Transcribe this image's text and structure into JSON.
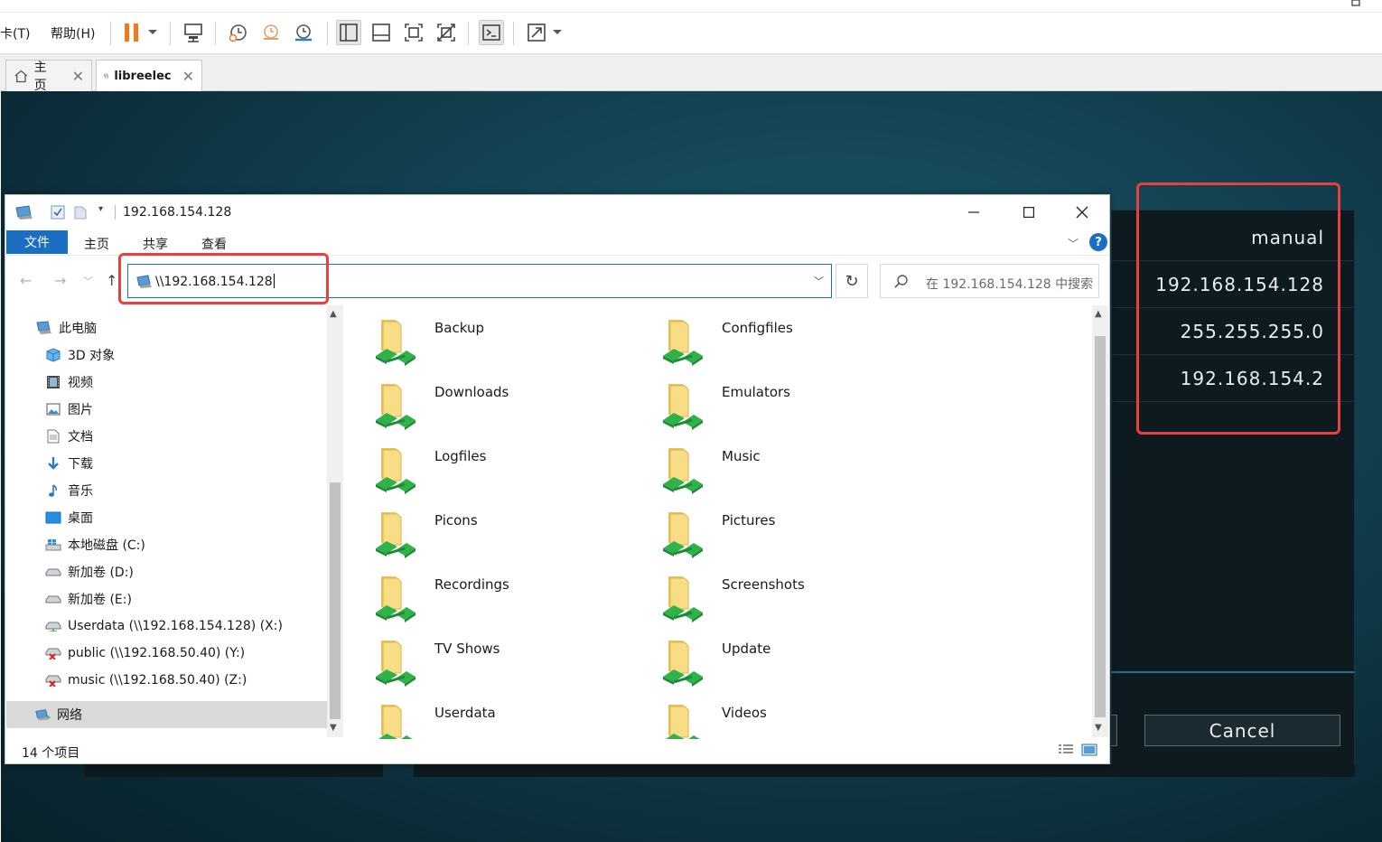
{
  "vm_toolbar": {
    "menu_tab_label": "卡(T)",
    "menu_help_label": "帮助(H)"
  },
  "vm_tabs": [
    {
      "label": "主页",
      "icon": "home-icon"
    },
    {
      "label": "libreelec",
      "icon": "vm-icon"
    }
  ],
  "kodi": {
    "values": [
      "manual",
      "192.168.154.128",
      "255.255.255.0",
      "192.168.154.2"
    ],
    "cancel_label": "Cancel"
  },
  "explorer": {
    "title": "192.168.154.128",
    "ribbon": {
      "file": "文件",
      "home": "主页",
      "share": "共享",
      "view": "查看",
      "help": "?"
    },
    "address": "\\\\192.168.154.128",
    "search_placeholder": "在 192.168.154.128 中搜索",
    "tree": [
      {
        "label": "此电脑",
        "icon": "computer-icon"
      },
      {
        "label": "3D 对象",
        "icon": "3d-objects-icon"
      },
      {
        "label": "视频",
        "icon": "video-icon"
      },
      {
        "label": "图片",
        "icon": "pictures-icon"
      },
      {
        "label": "文档",
        "icon": "documents-icon"
      },
      {
        "label": "下载",
        "icon": "download-icon"
      },
      {
        "label": "音乐",
        "icon": "music-icon"
      },
      {
        "label": "桌面",
        "icon": "desktop-icon"
      },
      {
        "label": "本地磁盘 (C:)",
        "icon": "windows-drive-icon"
      },
      {
        "label": "新加卷 (D:)",
        "icon": "drive-icon"
      },
      {
        "label": "新加卷 (E:)",
        "icon": "drive-icon"
      },
      {
        "label": "Userdata (\\\\192.168.154.128) (X:)",
        "icon": "network-drive-icon"
      },
      {
        "label": "public (\\\\192.168.50.40) (Y:)",
        "icon": "disconnected-drive-icon"
      },
      {
        "label": "music (\\\\192.168.50.40) (Z:)",
        "icon": "disconnected-drive-icon"
      },
      {
        "label": "网络",
        "icon": "network-icon"
      }
    ],
    "folders": [
      "Backup",
      "Configfiles",
      "Downloads",
      "Emulators",
      "Logfiles",
      "Music",
      "Picons",
      "Pictures",
      "Recordings",
      "Screenshots",
      "TV Shows",
      "Update",
      "Userdata",
      "Videos"
    ],
    "status": "14 个项目"
  },
  "colors": {
    "accent": "#1a6fc2",
    "annotation_red": "#e8403c",
    "share_green": "#2fb24a",
    "folder_yellow": "#f3d26a"
  }
}
